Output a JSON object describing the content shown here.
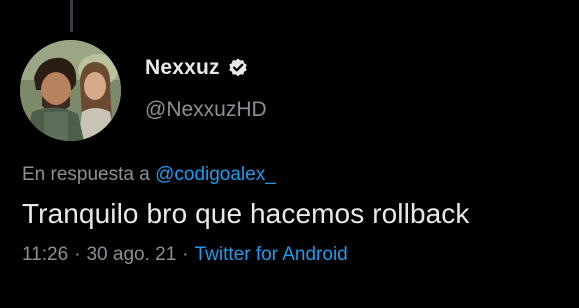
{
  "tweet": {
    "author": {
      "display_name": "Nexxuz",
      "handle": "@NexxuzHD",
      "verified_icon": "verified-badge-icon",
      "avatar_icon": "profile-photo"
    },
    "reply": {
      "prefix": "En respuesta a",
      "mention": "@codigoalex_"
    },
    "text": "Tranquilo bro que hacemos rollback",
    "meta": {
      "time": "11:26",
      "separator": "·",
      "date": "30 ago. 21",
      "source": "Twitter for Android"
    }
  },
  "colors": {
    "background": "#000000",
    "primary_text": "#e7e9ea",
    "secondary_text": "#8b9096",
    "link": "#1d9bf0"
  }
}
